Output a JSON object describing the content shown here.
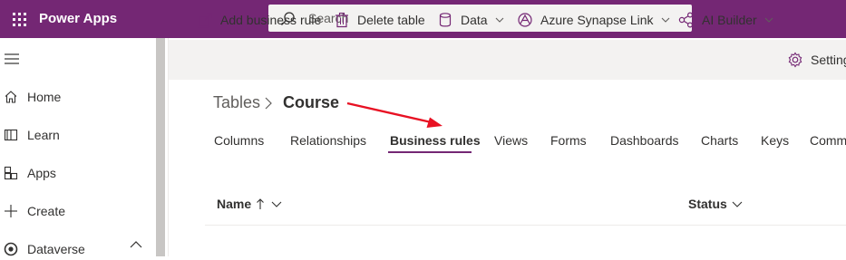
{
  "topbar": {
    "app_name": "Power Apps",
    "search_placeholder": "Search",
    "brand_color": "#742774"
  },
  "leftnav": {
    "items": [
      {
        "label": "Home",
        "icon": "home-icon"
      },
      {
        "label": "Learn",
        "icon": "book-icon"
      },
      {
        "label": "Apps",
        "icon": "apps-icon"
      },
      {
        "label": "Create",
        "icon": "plus-icon"
      },
      {
        "label": "Dataverse",
        "icon": "dataverse-icon",
        "expanded": true
      }
    ]
  },
  "commandbar": {
    "add_business_rule": "Add business rule",
    "delete_table": "Delete table",
    "data": "Data",
    "azure_synapse_link": "Azure Synapse Link",
    "ai_builder": "AI Builder",
    "settings": "Settings"
  },
  "breadcrumb": {
    "root": "Tables",
    "current": "Course"
  },
  "tabs": {
    "items": [
      "Columns",
      "Relationships",
      "Business rules",
      "Views",
      "Forms",
      "Dashboards",
      "Charts",
      "Keys",
      "Commands"
    ],
    "selected": "Business rules"
  },
  "grid": {
    "columns": {
      "name": "Name",
      "status": "Status"
    },
    "sort": "ascending"
  },
  "annotation": {
    "arrow_color": "#e81123"
  }
}
